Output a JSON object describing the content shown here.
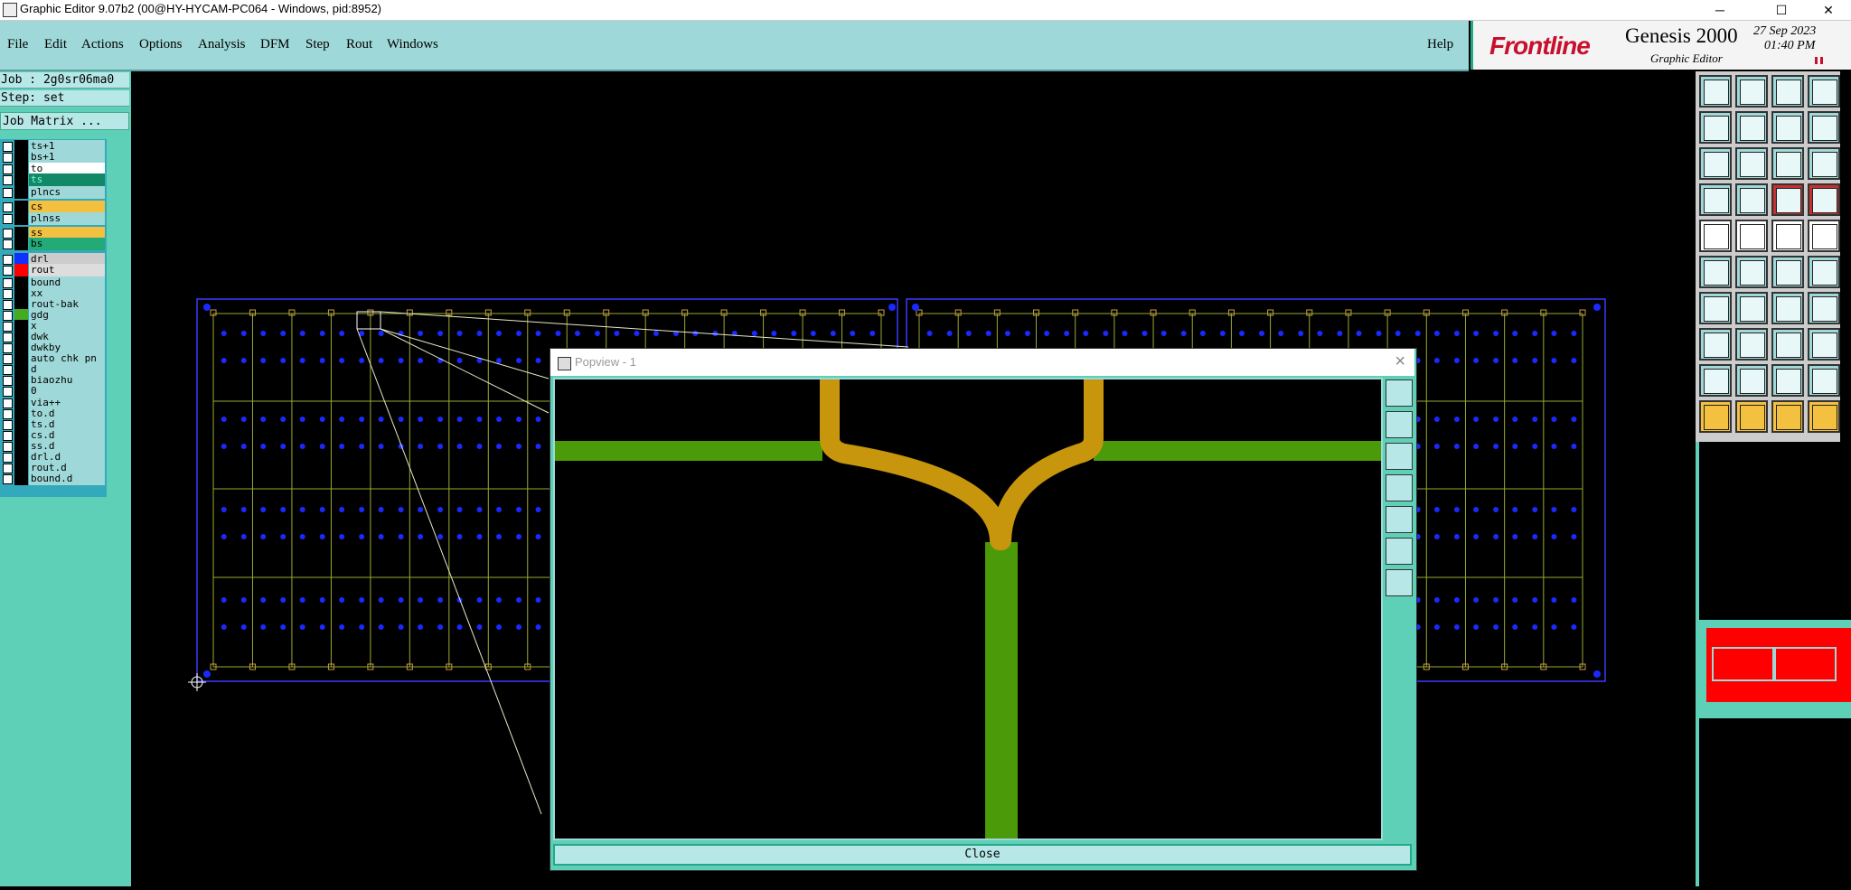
{
  "window": {
    "title": "Graphic Editor 9.07b2 (00@HY-HYCAM-PC064 - Windows, pid:8952)",
    "controls": [
      "─",
      "☐",
      "✕"
    ]
  },
  "menu": [
    "File",
    "Edit",
    "Actions",
    "Options",
    "Analysis",
    "DFM",
    "Step",
    "Rout",
    "Windows"
  ],
  "help": "Help",
  "brand": {
    "logo": "Frontline",
    "product": "Genesis 2000",
    "subtitle": "Graphic Editor",
    "date": "27 Sep 2023",
    "time": "01:40 PM"
  },
  "job": {
    "job_line": "Job : 2g0sr06ma0",
    "step_line": "Step: set",
    "matrix_button": "Job Matrix ..."
  },
  "layers": [
    {
      "name": "ts+1",
      "name_bg": "#9fd8d8",
      "swatch": "#000000"
    },
    {
      "name": "bs+1",
      "name_bg": "#9fd8d8",
      "swatch": "#000000"
    },
    {
      "name": "to",
      "name_bg": "#ffffff",
      "swatch": "#000000"
    },
    {
      "name": "ts",
      "name_bg": "#118866",
      "swatch": "#000000"
    },
    {
      "name": "plncs",
      "name_bg": "#9fd8d8",
      "swatch": "#000000"
    },
    {
      "name": "cs",
      "name_bg": "#f4c040",
      "swatch": "#000000"
    },
    {
      "name": "plnss",
      "name_bg": "#9fd8d8",
      "swatch": "#000000"
    },
    {
      "name": "ss",
      "name_bg": "#f4c040",
      "swatch": "#000000"
    },
    {
      "name": "bs",
      "name_bg": "#22aa77",
      "swatch": "#000000"
    },
    {
      "name": "drl",
      "name_bg": "#cccccc",
      "swatch": "#1030ff"
    },
    {
      "name": "rout",
      "name_bg": "#dddddd",
      "swatch": "#ff0000"
    },
    {
      "name": "bound",
      "name_bg": "#9fd8d8",
      "swatch": "#000000"
    },
    {
      "name": "xx",
      "name_bg": "#9fd8d8",
      "swatch": "#000000"
    },
    {
      "name": "rout-bak",
      "name_bg": "#9fd8d8",
      "swatch": "#000000"
    },
    {
      "name": "gdg",
      "name_bg": "#9fd8d8",
      "swatch": "#44aa22"
    },
    {
      "name": "x",
      "name_bg": "#9fd8d8",
      "swatch": "#000000"
    },
    {
      "name": "dwk",
      "name_bg": "#9fd8d8",
      "swatch": "#000000"
    },
    {
      "name": "dwkby",
      "name_bg": "#9fd8d8",
      "swatch": "#000000"
    },
    {
      "name": "auto_chk_pn",
      "name_bg": "#9fd8d8",
      "swatch": "#000000"
    },
    {
      "name": "d",
      "name_bg": "#9fd8d8",
      "swatch": "#000000"
    },
    {
      "name": "biaozhu",
      "name_bg": "#9fd8d8",
      "swatch": "#000000"
    },
    {
      "name": "0",
      "name_bg": "#9fd8d8",
      "swatch": "#000000"
    },
    {
      "name": "via++",
      "name_bg": "#9fd8d8",
      "swatch": "#000000"
    },
    {
      "name": "to.d",
      "name_bg": "#9fd8d8",
      "swatch": "#000000"
    },
    {
      "name": "ts.d",
      "name_bg": "#9fd8d8",
      "swatch": "#000000"
    },
    {
      "name": "cs.d",
      "name_bg": "#9fd8d8",
      "swatch": "#000000"
    },
    {
      "name": "ss.d",
      "name_bg": "#9fd8d8",
      "swatch": "#000000"
    },
    {
      "name": "drl.d",
      "name_bg": "#9fd8d8",
      "swatch": "#000000"
    },
    {
      "name": "rout.d",
      "name_bg": "#9fd8d8",
      "swatch": "#000000"
    },
    {
      "name": "bound.d",
      "name_bg": "#9fd8d8",
      "swatch": "#000000"
    }
  ],
  "popup": {
    "title": "Popview - 1",
    "close_label": "Close",
    "close_x": "×"
  },
  "toolbar": [
    [
      "open-icon",
      "save-icon",
      "home-icon",
      "grid-icon"
    ],
    [
      "zoom-prev-icon",
      "zoom-next-icon",
      "zoom-window-icon",
      "snap-icon"
    ],
    [
      "zoom-fit-icon",
      "zoom-center-icon",
      "scale-1-2-icon",
      "query-icon"
    ],
    [
      "settings-icon",
      "grid-display-icon",
      "layer-red-icon",
      "layer-red2-icon"
    ],
    [
      "pad-icon",
      "line-icon",
      "measure-icon",
      "circle-icon"
    ],
    [
      "connect-icon",
      "cross-icon",
      "move-icon",
      "copy-icon"
    ],
    [
      "draw-line-icon",
      "draw-line2-icon",
      "arc-icon",
      "parallel-icon"
    ],
    [
      "pad-red-icon",
      "minus-icon",
      "resize-icon",
      "group-icon"
    ],
    [
      "polygon-icon",
      "polygon2-icon",
      "polygon3-icon",
      "polygon4-icon"
    ],
    [
      "select-icon",
      "select2-icon",
      "select3-icon",
      "select4-icon"
    ]
  ],
  "colors": {
    "board_outline": "#3a3aff",
    "grid_lines": "#9aa830",
    "drill": "#1a2aff",
    "trace_green": "#4a9a0a",
    "trace_gold": "#c8960c"
  }
}
